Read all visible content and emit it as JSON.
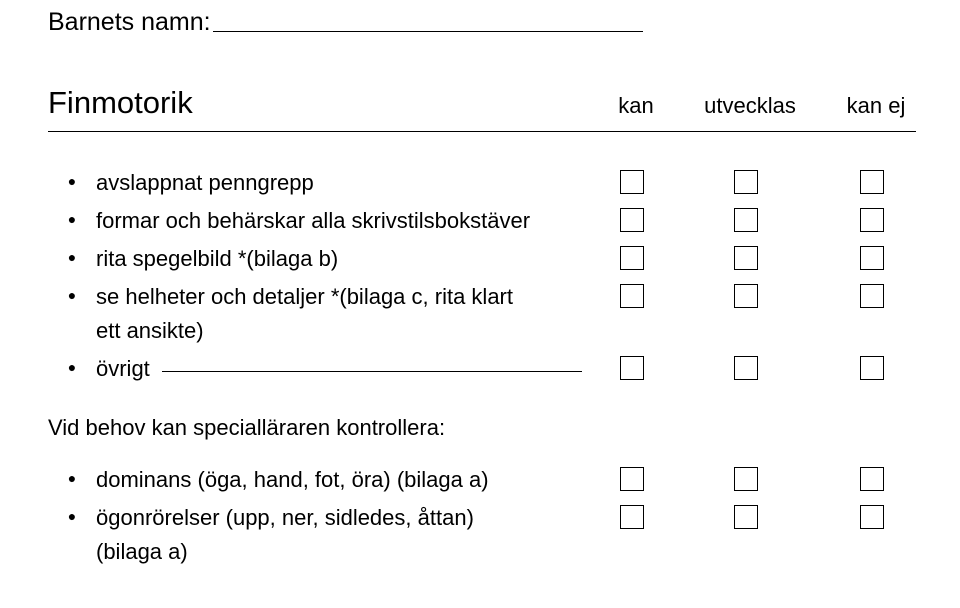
{
  "name_label": "Barnets namn:",
  "section": {
    "title": "Finmotorik",
    "cols": [
      "kan",
      "utvecklas",
      "kan ej"
    ]
  },
  "items_a": [
    "avslappnat penngrepp",
    "formar och behärskar alla skrivstilsbokstäver",
    "rita spegelbild *(bilaga b)",
    "se helheter och detaljer *(bilaga c, rita klart\nett ansikte)"
  ],
  "ovrigt_label": "övrigt",
  "subheading": "Vid behov kan specialläraren kontrollera:",
  "items_b": [
    "dominans (öga, hand, fot, öra) (bilaga a)",
    "ögonrörelser (upp, ner, sidledes, åttan)\n(bilaga a)"
  ]
}
